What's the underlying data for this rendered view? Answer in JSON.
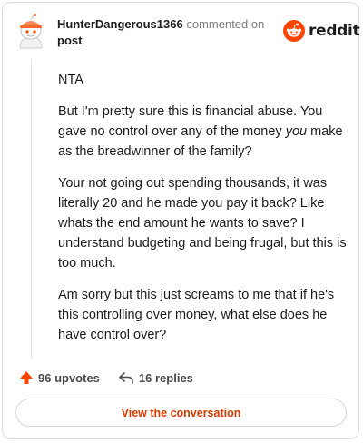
{
  "header": {
    "username": "HunterDangerous1366",
    "commented_text": "commented on",
    "post_link": "post",
    "brand": "reddit"
  },
  "comment": {
    "p1": "NTA",
    "p2_before": "But I'm pretty sure this is financial abuse. You gave no control over any of the money ",
    "p2_em": "you",
    "p2_after": " make as the breadwinner of the family?",
    "p3": "Your not going out spending thousands, it was literally 20 and he made you pay it back? Like whats the end amount he wants to save? I understand budgeting and being frugal, but this is too much.",
    "p4": "Am sorry but this just screams to me that if he's this controlling over money, what else does he have control over?"
  },
  "actions": {
    "upvotes": "96 upvotes",
    "replies": "16 replies"
  },
  "cta": {
    "label": "View the conversation"
  },
  "colors": {
    "accent": "#d93a00",
    "upvote": "#ff4500",
    "reddit_orange": "#ff4500"
  },
  "icons": {
    "avatar": "snoo-avatar-icon",
    "logo": "reddit-logo-icon",
    "upvote": "upvote-arrow-icon",
    "reply": "reply-arrow-icon"
  }
}
